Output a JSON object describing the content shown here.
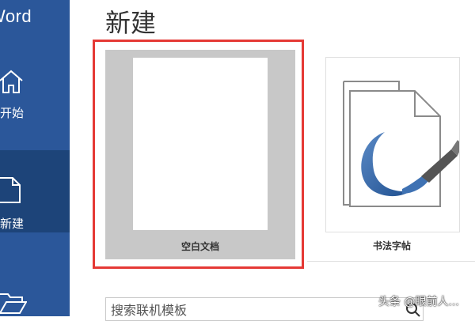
{
  "app": {
    "title": "Word"
  },
  "sidebar": {
    "items": [
      {
        "id": "home",
        "label": "开始",
        "icon": "home-icon"
      },
      {
        "id": "new",
        "label": "新建",
        "icon": "new-document-icon",
        "selected": true
      },
      {
        "id": "open",
        "label": "",
        "icon": "folder-icon"
      }
    ]
  },
  "main": {
    "heading": "新建",
    "templates": [
      {
        "label": "空白文档",
        "highlighted": true
      },
      {
        "label": "书法字帖"
      }
    ],
    "search": {
      "placeholder": "搜索联机模板"
    }
  },
  "watermark": "头条 @眼前人...",
  "colors": {
    "sidebar": "#2b579a",
    "sidebar_selected": "#1d4479",
    "highlight": "#e53935"
  }
}
